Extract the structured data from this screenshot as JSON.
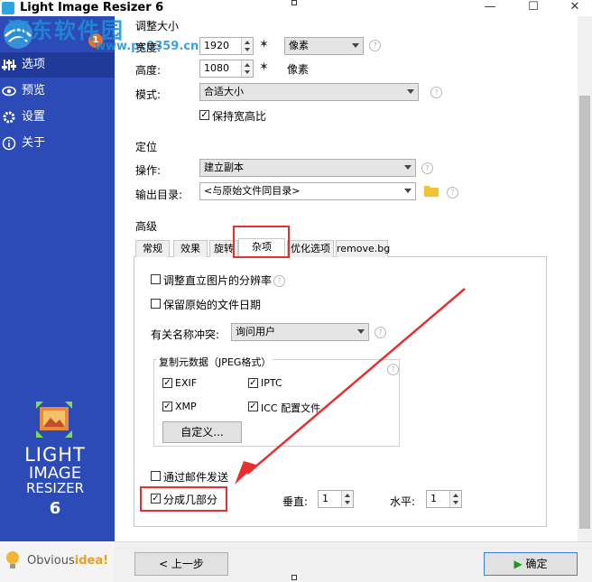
{
  "window": {
    "title": "Light Image Resizer 6",
    "minimize_glyph": "—",
    "maximize_glyph": "☐",
    "close_glyph": "✕"
  },
  "watermark": {
    "main": "河东软件园",
    "url": "www.pc0359.cn"
  },
  "sidebar": {
    "badge": "1",
    "items": [
      {
        "label": "选项",
        "icon": "sliders-icon"
      },
      {
        "label": "预览",
        "icon": "eye-icon"
      },
      {
        "label": "设置",
        "icon": "gear-icon"
      },
      {
        "label": "关于",
        "icon": "info-icon"
      }
    ],
    "brand_line1": "LIGHT",
    "brand_line2": "IMAGE",
    "brand_line3": "RESIZER",
    "brand_line4": "6",
    "footer_prefix": "Obvious",
    "footer_highlight": "idea!"
  },
  "size": {
    "section_label": "调整大小",
    "width_label": "宽度:",
    "width_value": "1920",
    "height_label": "高度:",
    "height_value": "1080",
    "unit_select": "像素",
    "unit_label": "像素",
    "mode_label": "模式:",
    "mode_value": "合适大小",
    "keep_ratio_label": "保持宽高比"
  },
  "positioning": {
    "section_label": "定位",
    "action_label": "操作:",
    "action_value": "建立副本",
    "output_label": "输出目录:",
    "output_value": "<与原始文件同目录>"
  },
  "advanced": {
    "section_label": "高级",
    "tabs": [
      "常规",
      "效果",
      "旋转",
      "杂项",
      "优化选项",
      "remove.bg"
    ],
    "adjust_resolution_label": "调整直立图片的分辨率",
    "keep_date_label": "保留原始的文件日期",
    "conflict_label": "有关名称冲突:",
    "conflict_value": "询问用户",
    "metadata_group_label": "复制元数据（JPEG格式）",
    "exif_label": "EXIF",
    "iptc_label": "IPTC",
    "xmp_label": "XMP",
    "icc_label": "ICC 配置文件",
    "custom_button": "自定义...",
    "email_label": "通过邮件发送",
    "split_label": "分成几部分",
    "vertical_label": "垂直:",
    "vertical_value": "1",
    "horizontal_label": "水平:",
    "horizontal_value": "1"
  },
  "footer": {
    "back_button": "< 上一步",
    "ok_button": "确定"
  },
  "colors": {
    "sidebar": "#2d4bb6",
    "annotation": "#e53030",
    "ok_arrow": "#1a9a1a"
  }
}
